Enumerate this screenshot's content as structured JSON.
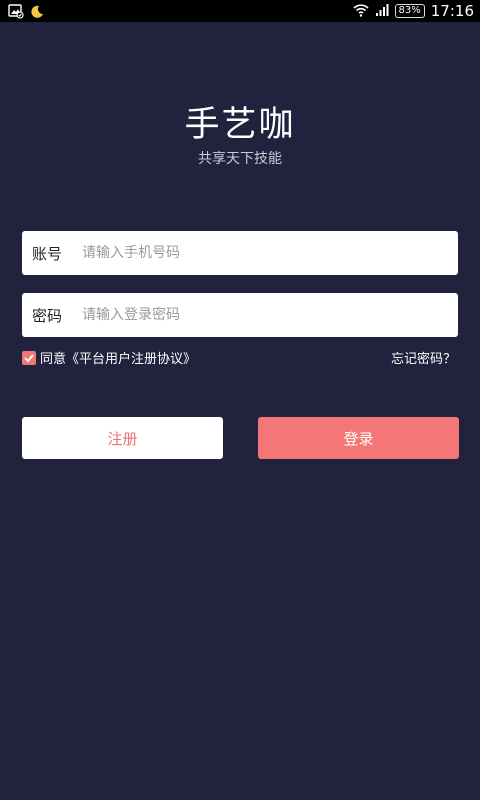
{
  "status_bar": {
    "time": "17:16",
    "battery": "83%",
    "icons": [
      "image-icon",
      "moon-icon",
      "wifi-icon",
      "signal-icon",
      "battery-icon"
    ]
  },
  "app": {
    "title": "手艺咖",
    "subtitle": "共享天下技能"
  },
  "form": {
    "account_label": "账号",
    "account_placeholder": "请输入手机号码",
    "account_value": "",
    "password_label": "密码",
    "password_placeholder": "请输入登录密码",
    "password_value": "",
    "agreement_checked": true,
    "agreement_text": "同意《平台用户注册协议》",
    "forgot_password": "忘记密码？"
  },
  "buttons": {
    "register": "注册",
    "login": "登录"
  },
  "colors": {
    "background": "#20223e",
    "accent": "#f47676",
    "field_bg": "#ffffff"
  }
}
